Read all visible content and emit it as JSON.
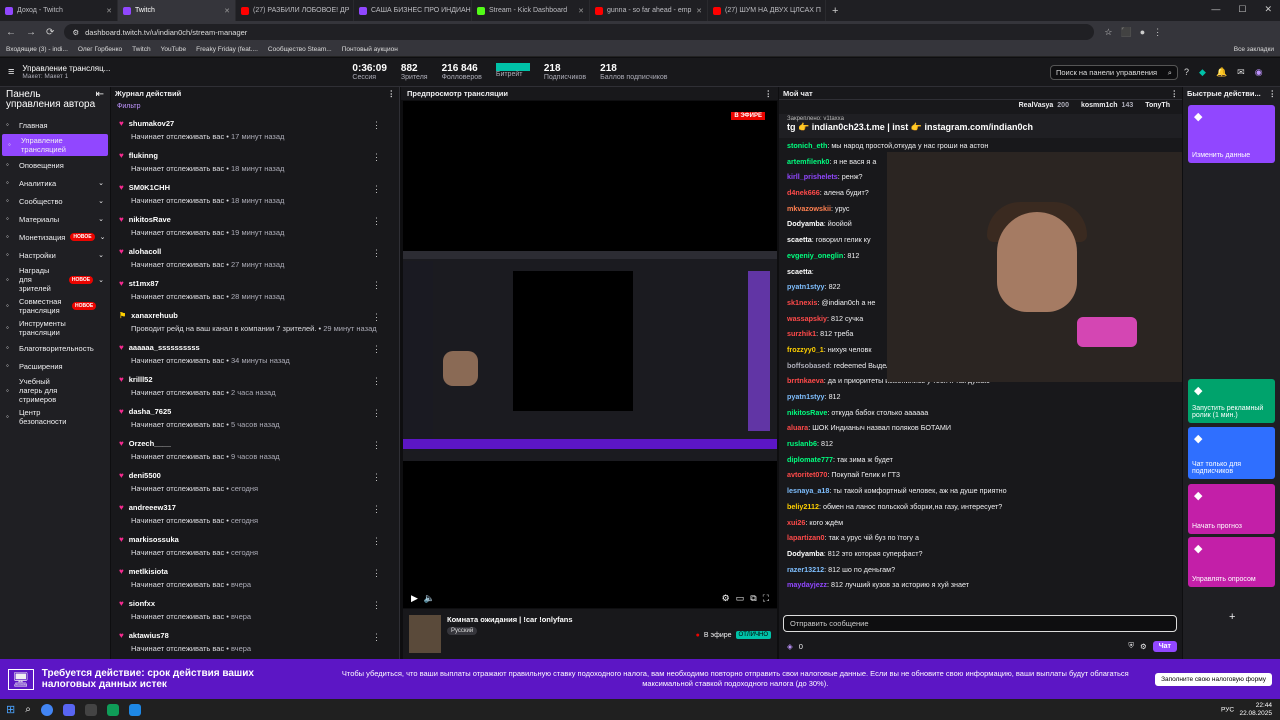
{
  "browser": {
    "tabs": [
      {
        "label": "Доход - Twitch",
        "color": "#9147ff",
        "active": false
      },
      {
        "label": "Twitch",
        "color": "#9147ff",
        "active": true
      },
      {
        "label": "(27) РАЗБИЛИ ЛОБОВОЕ! ДР",
        "color": "#ff0000",
        "active": false
      },
      {
        "label": "САША БИЗНЕС ПРО ИНДИАН",
        "color": "#9147ff",
        "active": false
      },
      {
        "label": "Stream - Kick Dashboard",
        "color": "#53fc18",
        "active": false
      },
      {
        "label": "gunna - so far ahead - emp",
        "color": "#ff0000",
        "active": false
      },
      {
        "label": "(27) ШУМ НА ДВУХ ЦЛСАХ П",
        "color": "#ff0000",
        "active": false
      }
    ],
    "url": "dashboard.twitch.tv/u/indian0ch/stream-manager",
    "bookmarks": [
      "Входящие (3) - indi...",
      "Олег Горбенко",
      "Twitch",
      "YouTube",
      "Freaky Friday (feat....",
      "Сообщество Steam...",
      "Понтовый аукцион"
    ],
    "all_bookmarks": "Все закладки"
  },
  "topbar": {
    "title": "Управление трансляц...",
    "subtitle": "Макет: Макет 1",
    "stats": [
      {
        "value": "0:36:09",
        "label": "Сессия"
      },
      {
        "value": "882",
        "label": "Зрителя"
      },
      {
        "value": "216 846",
        "label": "Фолловеров"
      },
      {
        "value": "",
        "label": "Битрейт"
      },
      {
        "value": "218",
        "label": "Подписчиков"
      },
      {
        "value": "218",
        "label": "Баллов подписчиков"
      }
    ],
    "search": "Поиск на панели управления"
  },
  "sidebar": {
    "header": "Панель управления автора",
    "items": [
      {
        "label": "Главная",
        "icon": "home-icon",
        "active": false,
        "chev": false,
        "new": false
      },
      {
        "label": "Управление трансляцией",
        "icon": "broadcast-icon",
        "active": true,
        "chev": false,
        "new": false
      },
      {
        "label": "Оповещения",
        "icon": "bell-icon",
        "active": false,
        "chev": false,
        "new": false
      },
      {
        "label": "Аналитика",
        "icon": "chart-icon",
        "active": false,
        "chev": true,
        "new": false
      },
      {
        "label": "Сообщество",
        "icon": "community-icon",
        "active": false,
        "chev": true,
        "new": false
      },
      {
        "label": "Материалы",
        "icon": "content-icon",
        "active": false,
        "chev": true,
        "new": false
      },
      {
        "label": "Монетизация",
        "icon": "money-icon",
        "active": false,
        "chev": true,
        "new": true
      },
      {
        "label": "Настройки",
        "icon": "gear-icon",
        "active": false,
        "chev": true,
        "new": false
      },
      {
        "label": "Награды для зрителей",
        "icon": "gift-icon",
        "active": false,
        "chev": true,
        "new": true
      },
      {
        "label": "Совместная трансляция",
        "icon": "collab-icon",
        "active": false,
        "chev": false,
        "new": true
      },
      {
        "label": "Инструменты трансляции",
        "icon": "tools-icon",
        "active": false,
        "chev": false,
        "new": false
      },
      {
        "label": "Благотворительность",
        "icon": "heart-icon",
        "active": false,
        "chev": false,
        "new": false
      },
      {
        "label": "Расширения",
        "icon": "puzzle-icon",
        "active": false,
        "chev": false,
        "new": false
      },
      {
        "label": "Учебный лагерь для стримеров",
        "icon": "school-icon",
        "active": false,
        "chev": false,
        "new": false
      },
      {
        "label": "Центр безопасности",
        "icon": "shield-icon",
        "active": false,
        "chev": false,
        "new": false
      }
    ],
    "new_badge": "НОВОЕ"
  },
  "activity": {
    "title": "Журнал действий",
    "filter": "Фильтр",
    "items": [
      {
        "name": "shumakov27",
        "action": "Начинает отслеживать вас",
        "time": "17 минут назад"
      },
      {
        "name": "flukinng",
        "action": "Начинает отслеживать вас",
        "time": "18 минут назад"
      },
      {
        "name": "SM0K1CHH",
        "action": "Начинает отслеживать вас",
        "time": "18 минут назад"
      },
      {
        "name": "nikitosRave",
        "action": "Начинает отслеживать вас",
        "time": "19 минут назад"
      },
      {
        "name": "alohacoll",
        "action": "Начинает отслеживать вас",
        "time": "27 минут назад"
      },
      {
        "name": "st1mx87",
        "action": "Начинает отслеживать вас",
        "time": "28 минут назад"
      },
      {
        "name": "xanaxrehuub",
        "action": "Проводит рейд на ваш канал в компании 7 зрителей.",
        "time": "29 минут назад"
      },
      {
        "name": "aaaaaa_ssssssssss",
        "action": "Начинает отслеживать вас",
        "time": "34 минуты назад"
      },
      {
        "name": "krilll52",
        "action": "Начинает отслеживать вас",
        "time": "2 часа назад"
      },
      {
        "name": "dasha_7625",
        "action": "Начинает отслеживать вас",
        "time": "5 часов назад"
      },
      {
        "name": "Orzech____",
        "action": "Начинает отслеживать вас",
        "time": "9 часов назад"
      },
      {
        "name": "deni5500",
        "action": "Начинает отслеживать вас",
        "time": "сегодня"
      },
      {
        "name": "andreeew317",
        "action": "Начинает отслеживать вас",
        "time": "сегодня"
      },
      {
        "name": "markisossuka",
        "action": "Начинает отслеживать вас",
        "time": "сегодня"
      },
      {
        "name": "metlkisiota",
        "action": "Начинает отслеживать вас",
        "time": "вчера"
      },
      {
        "name": "sionfxx",
        "action": "Начинает отслеживать вас",
        "time": "вчера"
      },
      {
        "name": "aktawius78",
        "action": "Начинает отслеживать вас",
        "time": "вчера"
      }
    ]
  },
  "preview": {
    "title": "Предпросмотр трансляции",
    "live": "В ЭФИРЕ",
    "stream_title": "Комната ожидания | !car !onlyfans",
    "tag": "Русский",
    "status": "В эфире",
    "status_badge": "ОТЛИЧНО"
  },
  "chat": {
    "title": "Мой чат",
    "top_users": [
      {
        "name": "RealVasya",
        "count": "200"
      },
      {
        "name": "kosmm1ch",
        "count": "143"
      },
      {
        "name": "TonyTh",
        "count": ""
      }
    ],
    "pinned_label": "Закреплено: v1taxxa",
    "pinned_text": "tg 👉 indian0ch23.t.me | inst 👉 instagram.com/indian0ch",
    "messages": [
      {
        "user": "stonich_eth",
        "color": "#00ff7f",
        "text": "мы народ простой,откуда у нас гроши на астон"
      },
      {
        "user": "artemfilenk0",
        "color": "#00ff7f",
        "text": "я не вася я а"
      },
      {
        "user": "kirll_prishelets",
        "color": "#9147ff",
        "text": "ренж?"
      },
      {
        "user": "d4nek666",
        "color": "#ff4a4a",
        "text": "алена будит?"
      },
      {
        "user": "mkvazowskii",
        "color": "#ff7f50",
        "text": "урус"
      },
      {
        "user": "Dodyamba",
        "color": "#ffffff",
        "text": "йоойой"
      },
      {
        "user": "scaetta",
        "color": "#ffffff",
        "text": "говорил гелик ку"
      },
      {
        "user": "evgeniy_oneglin",
        "color": "#00ff7f",
        "text": "812"
      },
      {
        "user": "scaetta",
        "color": "#ffffff",
        "text": ""
      },
      {
        "user": "pyatn1styy",
        "color": "#7fbfff",
        "text": "822"
      },
      {
        "user": "sk1nexis",
        "color": "#ff4a4a",
        "text": "@indian0ch а не"
      },
      {
        "user": "wassapskiy",
        "color": "#ff4a4a",
        "text": "812 сучка"
      },
      {
        "user": "surzhik1",
        "color": "#ff4a4a",
        "text": "812 треба"
      },
      {
        "user": "frozzyy0_1",
        "color": "#ffd000",
        "text": "нихуя человк"
      },
      {
        "user": "boffsobased",
        "color": "#adadb8",
        "text": "redeemed Выделить мое сообщение"
      },
      {
        "user": "brrtnkaeva",
        "color": "#ff4a4a",
        "text": "да и приоритеты изменились у тебя я так думаю"
      },
      {
        "user": "pyatn1styy",
        "color": "#7fbfff",
        "text": "812"
      },
      {
        "user": "nikitosRave",
        "color": "#00ff7f",
        "text": "откуда бабок столько аааааа"
      },
      {
        "user": "aluara",
        "color": "#ff4a4a",
        "text": "ШОК Индианыч назвал поляков БОТАМИ"
      },
      {
        "user": "ruslanb6",
        "color": "#00ff7f",
        "text": "812"
      },
      {
        "user": "diplomate777",
        "color": "#00ff7f",
        "text": "так зима ж будет"
      },
      {
        "user": "avtoritet070",
        "color": "#ff4a4a",
        "text": "Покупай Гелик и ГТ3"
      },
      {
        "user": "lesnaya_a18",
        "color": "#7fbfff",
        "text": "ты такой комфортный человек, аж на душе приятно"
      },
      {
        "user": "beliy2112",
        "color": "#ffd000",
        "text": "обмен на ланос польской зборки,на газу, интересует?"
      },
      {
        "user": "xui26",
        "color": "#ff4a4a",
        "text": "кого ждём"
      },
      {
        "user": "lapartizan0",
        "color": "#ff4a4a",
        "text": "так а урус чій буз по їтогу а"
      },
      {
        "user": "Dodyamba",
        "color": "#ffffff",
        "text": "812 это которая суперфаст?"
      },
      {
        "user": "razer13212",
        "color": "#7fbfff",
        "text": "812 шо по деньгам?"
      },
      {
        "user": "maydayjezz",
        "color": "#9147ff",
        "text": "812 лучший кузов за историю я хуй знает"
      }
    ],
    "input_placeholder": "Отправить сообщение",
    "points": "0",
    "send": "Чат"
  },
  "quick": {
    "title": "Быстрые действи...",
    "actions": [
      {
        "label": "Изменить данные",
        "color": "#9147ff",
        "icon": "pencil-icon"
      },
      {
        "label": "Запустить рекламный ролик (1 мин.)",
        "color": "#00a36c",
        "icon": "ad-icon"
      },
      {
        "label": "Чат только для подписчиков",
        "color": "#2f6fff",
        "icon": "star-icon"
      },
      {
        "label": "Начать прогноз",
        "color": "#c31fa8",
        "icon": "prediction-icon"
      },
      {
        "label": "Управлять опросом",
        "color": "#c31fa8",
        "icon": "poll-icon"
      }
    ],
    "add": "+"
  },
  "banner": {
    "title": "Требуется действие: срок действия ваших налоговых данных истек",
    "body": "Чтобы убедиться, что ваши выплаты отражают правильную ставку подоходного налога, вам необходимо повторно отправить свои налоговые данные. Если вы не обновите свою информацию, ваши выплаты будут облагаться максимальной ставкой подоходного налога (до 30%).",
    "button": "Заполните свою налоговую форму"
  },
  "taskbar": {
    "lang": "РУС",
    "time": "22:44",
    "date": "22.08.2025"
  }
}
